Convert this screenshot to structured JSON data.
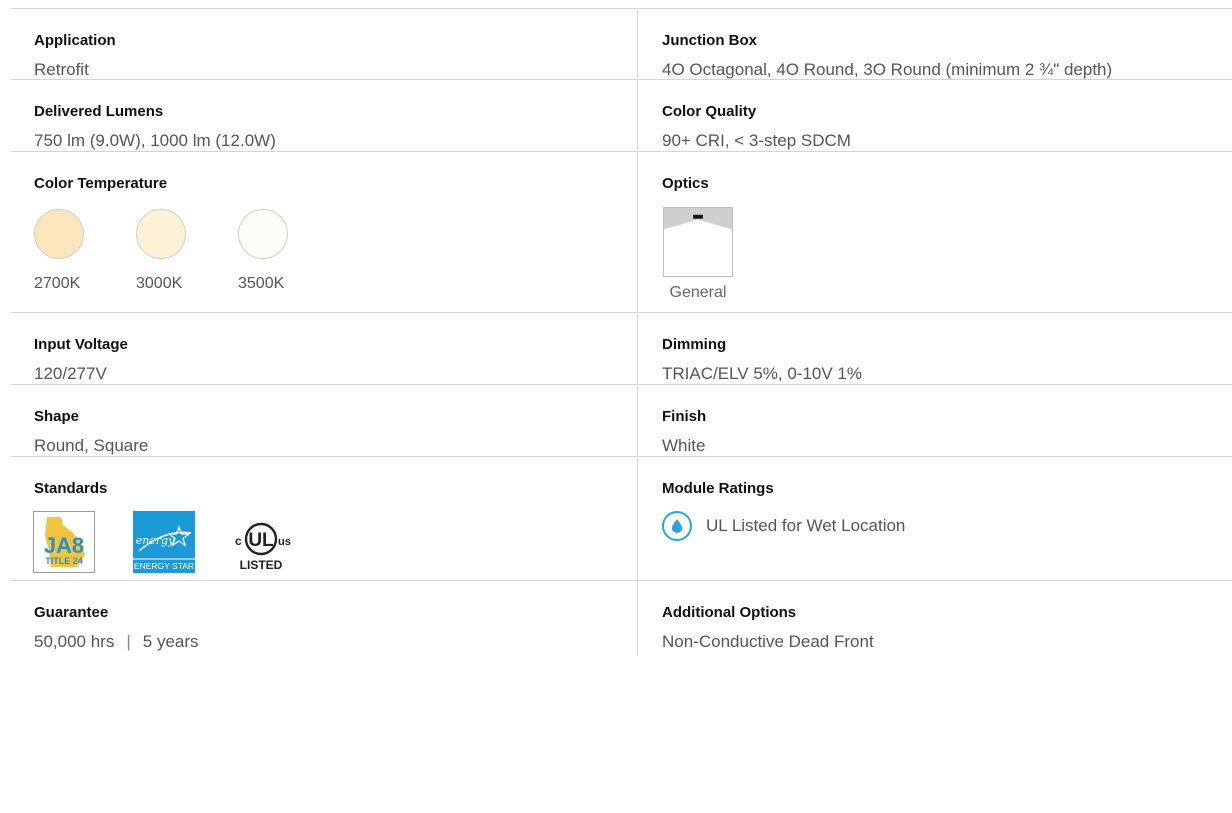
{
  "specs": {
    "application": {
      "label": "Application",
      "value": "Retrofit"
    },
    "junction_box": {
      "label": "Junction Box",
      "value": "4O Octagonal, 4O Round, 3O Round (minimum 2 ¾\" depth)"
    },
    "delivered_lumens": {
      "label": "Delivered Lumens",
      "value": "750 lm (9.0W), 1000 lm (12.0W)"
    },
    "color_quality": {
      "label": "Color Quality",
      "value": "90+ CRI, < 3-step SDCM"
    },
    "color_temperature": {
      "label": "Color Temperature",
      "swatches": [
        {
          "label": "2700K",
          "color": "#fbe5bd"
        },
        {
          "label": "3000K",
          "color": "#fdf2d6"
        },
        {
          "label": "3500K",
          "color": "#fdfbf6"
        }
      ]
    },
    "optics": {
      "label": "Optics",
      "option": "General",
      "icon": "general-optic-icon"
    },
    "input_voltage": {
      "label": "Input Voltage",
      "value": "120/277V"
    },
    "dimming": {
      "label": "Dimming",
      "value": "TRIAC/ELV 5%, 0-10V 1%"
    },
    "shape": {
      "label": "Shape",
      "value": "Round, Square"
    },
    "finish": {
      "label": "Finish",
      "value": "White"
    },
    "standards": {
      "label": "Standards",
      "ja8": {
        "line1": "JA8",
        "line2": "TITLE 24",
        "icon": "ja8-title24-logo"
      },
      "energy_star": {
        "script": "energy",
        "caption": "ENERGY STAR",
        "icon": "energy-star-logo"
      },
      "ul": {
        "c": "c",
        "ul": "UL",
        "us": "us",
        "listed": "LISTED",
        "icon": "ul-listed-logo"
      }
    },
    "module_ratings": {
      "label": "Module Ratings",
      "value": "UL Listed for Wet Location",
      "icon": "water-drop-icon"
    },
    "guarantee": {
      "label": "Guarantee",
      "hours": "50,000 hrs",
      "separator": "|",
      "years": "5 years"
    },
    "additional_options": {
      "label": "Additional Options",
      "value": "Non-Conductive Dead Front"
    }
  },
  "colors": {
    "accent_blue": "#2aa3df",
    "divider": "#d4d4d4",
    "ja8_yellow": "#f1c43f",
    "ja8_blue": "#2b8fcf",
    "energy_star_blue": "#1b9ad6"
  }
}
